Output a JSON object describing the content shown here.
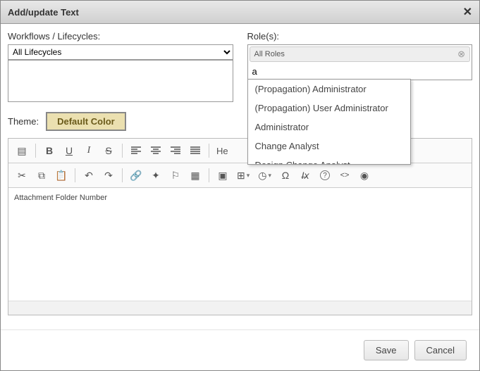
{
  "dialog": {
    "title": "Add/update Text",
    "close_glyph": "✕"
  },
  "workflows": {
    "label": "Workflows / Lifecycles:",
    "selected": "All Lifecycles"
  },
  "roles": {
    "label": "Role(s):",
    "chip": "All Roles",
    "chip_close_glyph": "⊗",
    "search_value": "a",
    "suggestions": [
      "(Propagation) Administrator",
      "(Propagation) User Administrator",
      "Administrator",
      "Change Analyst",
      "Design Change Analyst"
    ]
  },
  "theme": {
    "label": "Theme:",
    "button": "Default Color"
  },
  "editor": {
    "heading_label": "He",
    "content": "Attachment Folder Number"
  },
  "toolbar_icons": {
    "source": "▤",
    "bold": "B",
    "underline": "U",
    "italic": "I",
    "strike": "S",
    "align_left": "≡",
    "align_center": "≡",
    "align_right": "≡",
    "align_justify": "≡",
    "cut": "✂",
    "copy": "⧉",
    "paste": "📋",
    "undo": "↶",
    "redo": "↷",
    "link": "🔗",
    "unlink": "✦",
    "bookmark": "⚐",
    "table_ins": "▦",
    "image": "▣",
    "table": "⊞",
    "clock": "◷",
    "special": "Ω",
    "clear": "I̶x",
    "help": "?",
    "code": "<>",
    "preview": "◉",
    "caret": "▾"
  },
  "footer": {
    "save": "Save",
    "cancel": "Cancel"
  }
}
